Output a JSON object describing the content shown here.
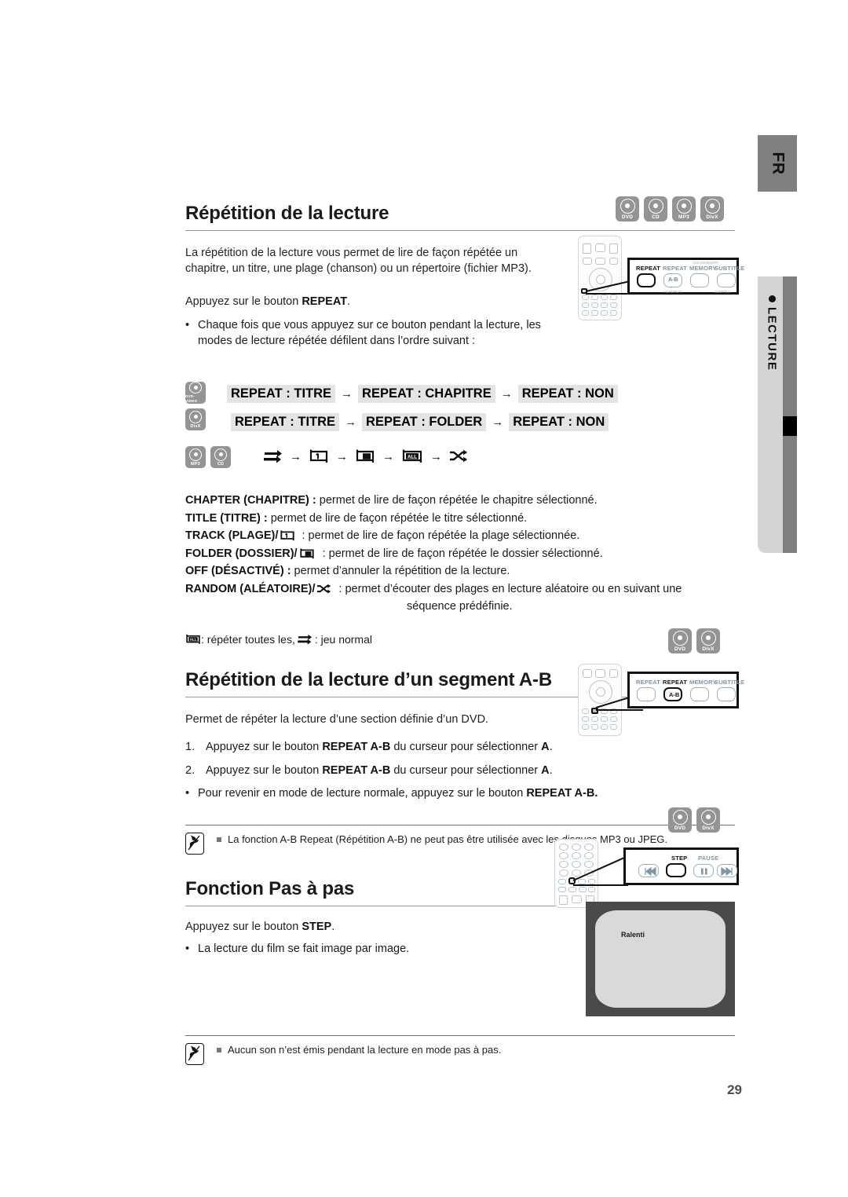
{
  "document": {
    "language_tab": "FR",
    "section_tab": "LECTURE",
    "page_number": "29"
  },
  "sections": [
    {
      "id": "repetition-lecture",
      "title": "Répétition de la lecture",
      "badges": [
        "DVD",
        "CD",
        "MP3",
        "DivX"
      ],
      "intro": "La répétition de la lecture vous permet de lire de façon répétée un chapitre, un titre, une plage (chanson) ou un répertoire (fichier MP3).",
      "instruction_prefix": "Appuyez sur le bouton ",
      "instruction_bold": "REPEAT",
      "instruction_suffix": ".",
      "bullet": "Chaque fois que vous appuyez sur ce bouton pendant la lecture, les modes de lecture répétée défilent dans l’ordre suivant :",
      "remote": {
        "callout_keys": [
          {
            "label": "REPEAT",
            "sub": "",
            "active": true
          },
          {
            "label": "REPEAT",
            "sub": "A-B",
            "active": false
          },
          {
            "label": "MEMORY",
            "sub": "",
            "active": false
          },
          {
            "label": "SUBTITLE",
            "sub": "",
            "active": false
          }
        ]
      }
    }
  ],
  "flow": {
    "row1": {
      "badge": "DVD-VIDEO",
      "items": [
        "REPEAT : TITRE",
        "REPEAT : CHAPITRE",
        "REPEAT : NON"
      ],
      "arrow": "→"
    },
    "row2": {
      "badge": "DivX",
      "items": [
        "REPEAT : TITRE",
        "REPEAT : FOLDER",
        "REPEAT : NON"
      ],
      "arrow": "→"
    },
    "row3": {
      "badges": [
        "MP3",
        "CD"
      ],
      "icons": [
        "normal-play-icon",
        "repeat-track-icon",
        "repeat-folder-icon",
        "repeat-all-icon",
        "shuffle-icon"
      ],
      "arrow": "→"
    }
  },
  "definitions": [
    {
      "term": "CHAPTER (CHAPITRE) :",
      "icon": "",
      "desc": " permet de lire de façon répétée le chapitre sélectionné."
    },
    {
      "term": "TITLE (TITRE) :",
      "icon": "",
      "desc": " permet de lire de façon répétée le titre sélectionné."
    },
    {
      "term": "TRACK (PLAGE)/",
      "icon": "repeat-track-icon",
      "desc": " : permet de lire de façon répétée la plage sélectionnée."
    },
    {
      "term": "FOLDER (DOSSIER)/",
      "icon": "repeat-folder-icon",
      "desc": " : permet de lire de façon répétée le dossier sélectionné."
    },
    {
      "term": "OFF (DÉSACTIVÉ) :",
      "icon": "",
      "desc": "  permet d’annuler la répétition de la lecture."
    },
    {
      "term": "RANDOM (ALÉATOIRE)/",
      "icon": "shuffle-icon",
      "desc": " : permet d’écouter des plages en lecture aléatoire ou en suivant une"
    },
    {
      "term": "",
      "icon": "",
      "desc": "séquence prédéfinie.",
      "indent": true
    }
  ],
  "legend": {
    "all_icon": "repeat-all-icon",
    "all_text": " : répéter toutes les, ",
    "normal_icon": "normal-play-icon",
    "normal_text": " : jeu normal"
  },
  "section_ab": {
    "title": "Répétition de la lecture d’un segment A-B",
    "badges": [
      "DVD",
      "DivX"
    ],
    "intro": "Permet de répéter la lecture d’une section définie d’un DVD.",
    "steps": [
      {
        "num": "1.",
        "pre": "Appuyez sur le bouton ",
        "bold": "REPEAT A-B",
        "mid": " du curseur pour sélectionner ",
        "bold2": "A",
        "post": "."
      },
      {
        "num": "2.",
        "pre": "Appuyez sur le bouton ",
        "bold": "REPEAT A-B",
        "mid": " du curseur pour sélectionner ",
        "bold2": "A",
        "post": "."
      }
    ],
    "bullet_pre": "Pour revenir en mode de lecture normale, appuyez sur le bouton ",
    "bullet_bold": "REPEAT A-B.",
    "remote": {
      "callout_keys": [
        {
          "label": "REPEAT",
          "sub": "",
          "active": false
        },
        {
          "label": "REPEAT",
          "sub": "A-B",
          "active": true
        },
        {
          "label": "MEMORY",
          "sub": "",
          "active": false
        },
        {
          "label": "SUBTITLE",
          "sub": "",
          "active": false
        }
      ]
    },
    "note": "La fonction A-B Repeat (Répétition A-B) ne peut pas être utilisée avec les disques MP3 ou JPEG."
  },
  "section_step": {
    "title": "Fonction Pas à pas",
    "badges": [
      "DVD",
      "DivX"
    ],
    "instruction_prefix": "Appuyez sur le bouton ",
    "instruction_bold": "STEP",
    "instruction_suffix": ".",
    "bullet": "La lecture du film se fait image par image.",
    "remote": {
      "callout_keys": [
        {
          "label": "",
          "sub": "prev",
          "active": false
        },
        {
          "label": "STEP",
          "sub": "",
          "active": true
        },
        {
          "label": "PAUSE",
          "sub": "pause",
          "active": false
        },
        {
          "label": "",
          "sub": "next",
          "active": false
        }
      ]
    },
    "tv_osd": "Ralenti",
    "note": "Aucun son n’est émis pendant la lecture en mode pas à pas."
  },
  "colors": {
    "badge_gray": "#949494",
    "highlight_gray": "#e4e4e4",
    "tab_gray": "#808080",
    "tab_light": "#d4d4d4",
    "rule_gray": "#9a9a9a"
  }
}
